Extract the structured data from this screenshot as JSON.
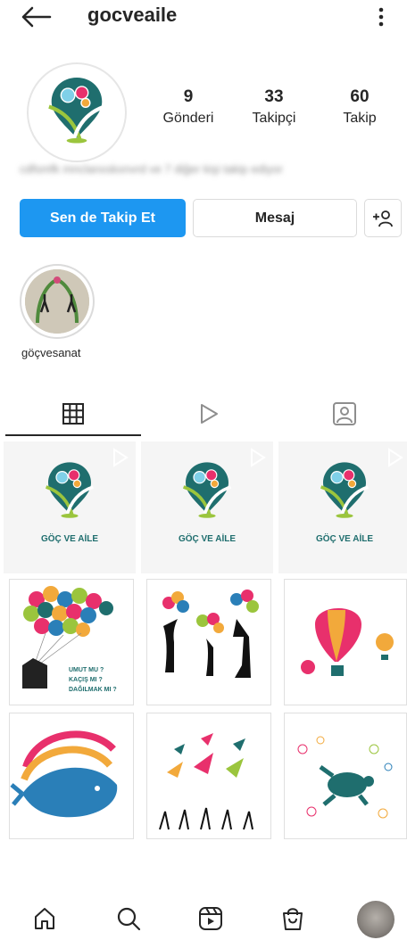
{
  "header": {
    "username": "gocveaile"
  },
  "profile": {
    "stats": [
      {
        "value": "9",
        "label": "Gönderi"
      },
      {
        "value": "33",
        "label": "Takipçi"
      },
      {
        "value": "60",
        "label": "Takip"
      }
    ],
    "bio_blurred": "cdfsmfk mnclanxskxnvrd ve 7 diğer kişi takip ediyor"
  },
  "actions": {
    "follow_label": "Sen de Takip Et",
    "message_label": "Mesaj"
  },
  "highlight": {
    "label": "göçvesanat"
  },
  "grid": {
    "logo_caption": "GÖÇ VE AİLE",
    "poster_lines": [
      "UMUT MU ?",
      "KAÇIŞ MI ?",
      "DAĞILMAK MI ?"
    ]
  },
  "colors": {
    "accent": "#1d97f1",
    "brand_teal": "#1f6e6e",
    "brand_green": "#9bc53d",
    "brand_pink": "#e8306c"
  }
}
